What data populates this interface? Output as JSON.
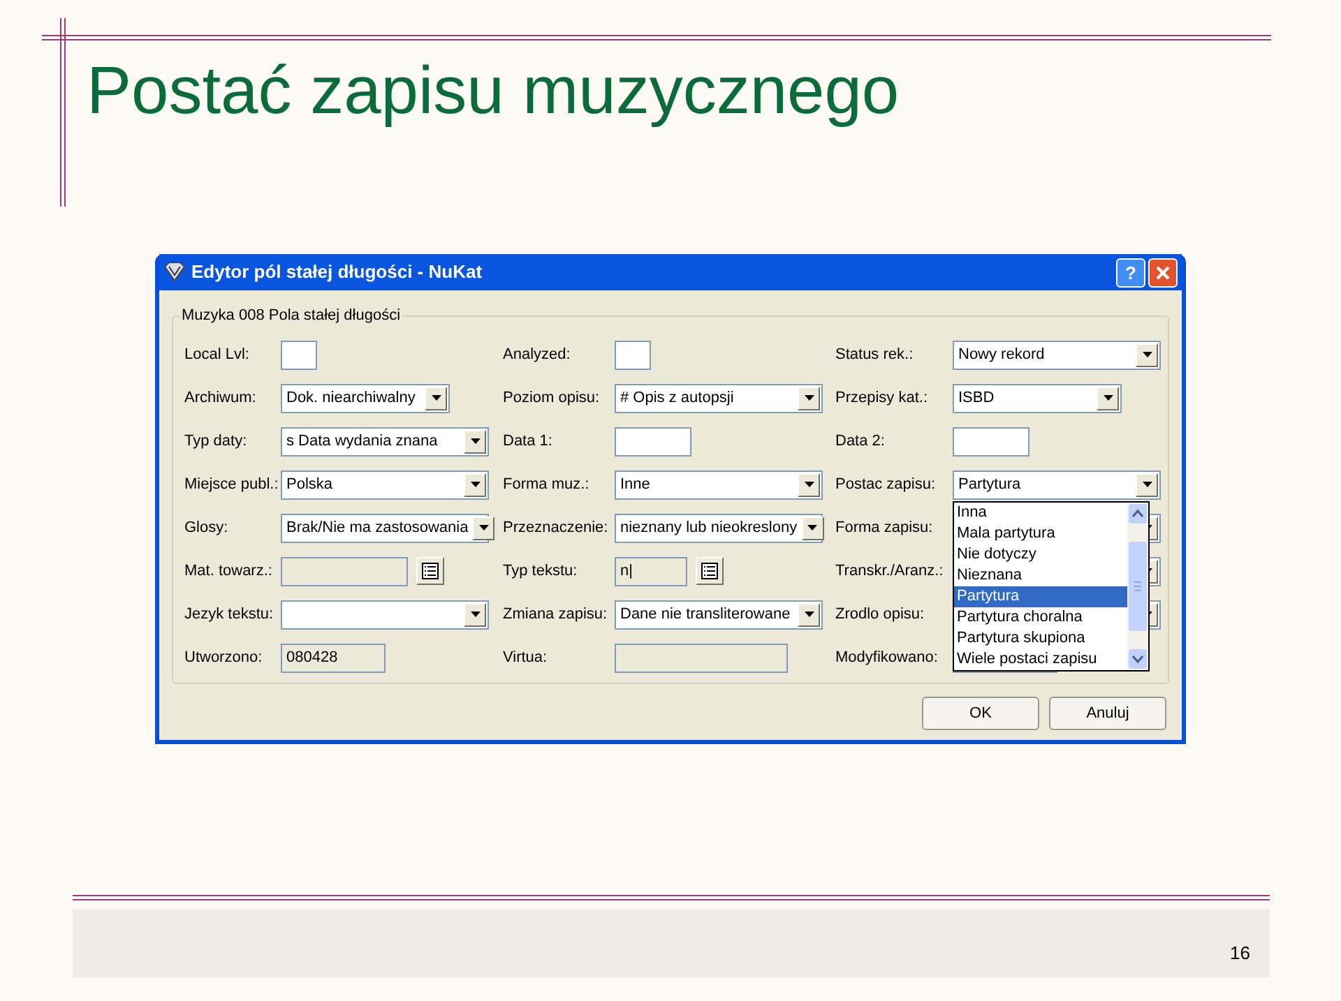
{
  "slide": {
    "title": "Postać zapisu muzycznego",
    "page_number": "16"
  },
  "dialog": {
    "title": "Edytor pól stałej długości - NuKat",
    "help_button": "?",
    "group_title": "Muzyka 008 Pola stałej długości",
    "rows": [
      [
        {
          "label": "Local Lvl:",
          "kind": "box"
        },
        {
          "label": "Analyzed:",
          "kind": "box"
        },
        {
          "label": "Status rek.:",
          "kind": "select",
          "value": "Nowy rekord"
        }
      ],
      [
        {
          "label": "Archiwum:",
          "kind": "short-select",
          "value": "Dok. niearchiwalny"
        },
        {
          "label": "Poziom opisu:",
          "kind": "select",
          "value": "# Opis z autopsji"
        },
        {
          "label": "Przepisy kat.:",
          "kind": "short-select",
          "value": "ISBD"
        }
      ],
      [
        {
          "label": "Typ daty:",
          "kind": "select",
          "value": "s Data wydania znana"
        },
        {
          "label": "Data 1:",
          "kind": "text"
        },
        {
          "label": "Data 2:",
          "kind": "text"
        }
      ],
      [
        {
          "label": "Miejsce publ.:",
          "kind": "select",
          "value": "Polska"
        },
        {
          "label": "Forma muz.:",
          "kind": "select",
          "value": "Inne"
        },
        {
          "label": "Postac zapisu:",
          "kind": "select",
          "value": "Partytura",
          "expanded": true
        }
      ],
      [
        {
          "label": "Glosy:",
          "kind": "select",
          "value": "Brak/Nie ma zastosowania"
        },
        {
          "label": "Przeznaczenie:",
          "kind": "select",
          "value": "nieznany lub nieokreslony"
        },
        {
          "label": "Forma zapisu:",
          "kind": "select"
        }
      ],
      [
        {
          "label": "Mat. towarz.:",
          "kind": "lookup"
        },
        {
          "label": "Typ tekstu:",
          "kind": "lookup",
          "value": "n|"
        },
        {
          "label": "Transkr./Aranz.:",
          "kind": "select"
        }
      ],
      [
        {
          "label": "Jezyk tekstu:",
          "kind": "select"
        },
        {
          "label": "Zmiana zapisu:",
          "kind": "select",
          "value": "Dane nie transliterowane"
        },
        {
          "label": "Zrodlo opisu:",
          "kind": "select"
        }
      ],
      [
        {
          "label": "Utworzono:",
          "kind": "readonly",
          "value": "080428"
        },
        {
          "label": "Virtua:",
          "kind": "wide-readonly"
        },
        {
          "label": "Modyfikowano:",
          "kind": "readonly"
        }
      ]
    ],
    "dropdown_options": [
      {
        "label": "Inna",
        "selected": false
      },
      {
        "label": "Mala partytura",
        "selected": false
      },
      {
        "label": "Nie dotyczy",
        "selected": false
      },
      {
        "label": "Nieznana",
        "selected": false
      },
      {
        "label": "Partytura",
        "selected": true
      },
      {
        "label": "Partytura choralna",
        "selected": false
      },
      {
        "label": "Partytura skupiona",
        "selected": false
      },
      {
        "label": "Wiele postaci zapisu",
        "selected": false
      }
    ],
    "buttons": [
      "OK",
      "Anuluj"
    ]
  }
}
